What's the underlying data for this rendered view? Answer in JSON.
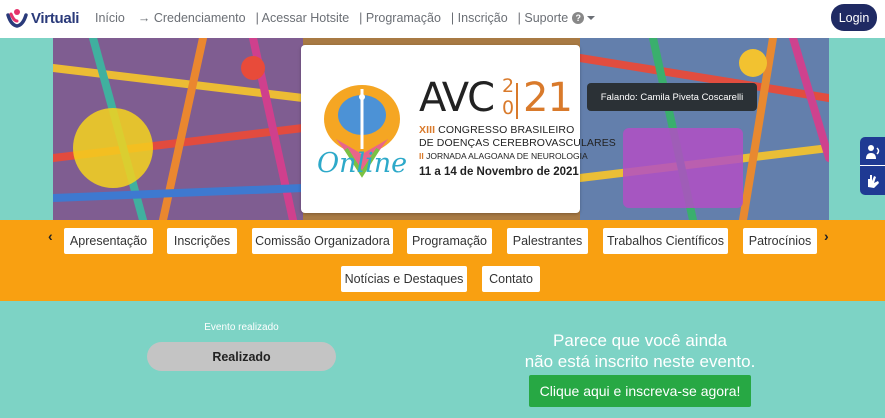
{
  "brand": {
    "name": "Virtuali"
  },
  "nav": {
    "links": [
      "Início",
      "→ Credenciamento",
      "| Acessar Hotsite",
      "| Programação",
      "| Inscrição",
      "| Suporte"
    ],
    "support_badge": "?",
    "login_label": "Login"
  },
  "banner": {
    "title_prefix": "AVC",
    "year_top": "2",
    "year_bottom": "0",
    "year_big": "21",
    "online": "Online",
    "congress_line1_num": "XIII",
    "congress_line1_text": " CONGRESSO BRASILEIRO",
    "congress_line2": "DE DOENÇAS CEREBROVASCULARES",
    "congress_line3_num": "II",
    "congress_line3_text": " JORNADA ALAGOANA DE NEUROLOGIA",
    "dates": "11 a 14 de Novembro de 2021",
    "tooltip": "Falando: Camila Piveta Coscarelli"
  },
  "tabs": {
    "prev_arrow": "‹",
    "next_arrow": "›",
    "items": [
      "Apresentação",
      "Inscrições",
      "Comissão Organizadora",
      "Programação",
      "Palestrantes",
      "Trabalhos Científicos",
      "Patrocínios",
      "Notícias e Destaques",
      "Contato"
    ]
  },
  "event_status": {
    "label": "Evento realizado",
    "value": "Realizado"
  },
  "registration": {
    "message_line1": "Parece que você ainda",
    "message_line2": "não está inscrito neste evento.",
    "cta_label": "Clique aqui e inscreva-se agora!"
  },
  "colors": {
    "background": "#7dd3c5",
    "tab_bar": "#f9a011",
    "login": "#1f2a63",
    "cta": "#27a844",
    "accent_orange": "#d97a2b"
  },
  "icons": {
    "accessibility_top": "sign-language-icon",
    "accessibility_bottom": "hands-icon"
  }
}
